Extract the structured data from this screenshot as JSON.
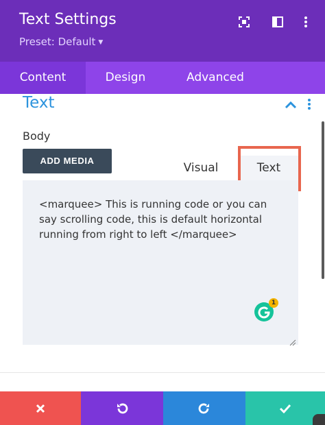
{
  "header": {
    "title": "Text Settings",
    "preset_label": "Preset: Default",
    "icons": [
      "focus-icon",
      "sidebar-layout-icon",
      "more-vertical-icon"
    ]
  },
  "tabs": [
    {
      "label": "Content",
      "active": true
    },
    {
      "label": "Design",
      "active": false
    },
    {
      "label": "Advanced",
      "active": false
    }
  ],
  "section": {
    "title": "Text",
    "icons": [
      "chevron-up-icon",
      "more-vertical-icon"
    ]
  },
  "body": {
    "label": "Body",
    "add_media_label": "ADD MEDIA",
    "editor_tabs": [
      {
        "label": "Visual",
        "active": false
      },
      {
        "label": "Text",
        "active": true
      }
    ],
    "editor_value": "<marquee> This is running code or you can say scrolling code, this is default horizontal running from right to left </marquee>",
    "grammarly_count": "1"
  },
  "footer": {
    "buttons": [
      {
        "name": "discard",
        "icon": "close-icon",
        "color": "#ef5350"
      },
      {
        "name": "undo",
        "icon": "undo-icon",
        "color": "#7b36d9"
      },
      {
        "name": "redo",
        "icon": "redo-icon",
        "color": "#2b87da"
      },
      {
        "name": "save",
        "icon": "check-icon",
        "color": "#29c4a9"
      }
    ]
  },
  "colors": {
    "header_bg": "#6c2eb9",
    "tabs_bg": "#8e44e9",
    "section_title": "#2c93dd",
    "highlight_border": "#e8664e"
  }
}
